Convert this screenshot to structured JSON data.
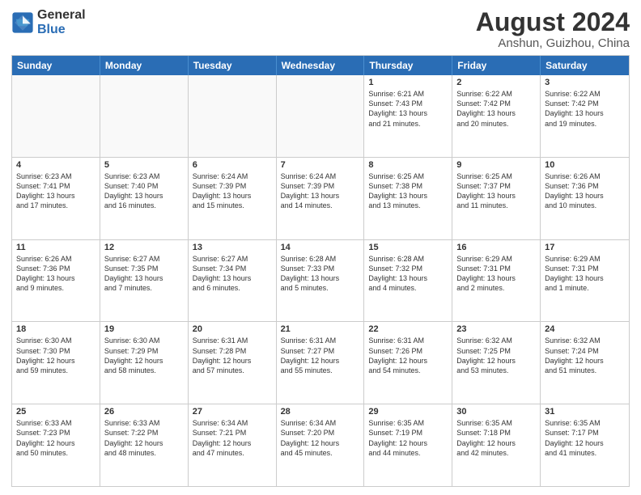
{
  "logo": {
    "line1": "General",
    "line2": "Blue"
  },
  "title": "August 2024",
  "subtitle": "Anshun, Guizhou, China",
  "header_days": [
    "Sunday",
    "Monday",
    "Tuesday",
    "Wednesday",
    "Thursday",
    "Friday",
    "Saturday"
  ],
  "rows": [
    [
      {
        "day": "",
        "text": "",
        "empty": true
      },
      {
        "day": "",
        "text": "",
        "empty": true
      },
      {
        "day": "",
        "text": "",
        "empty": true
      },
      {
        "day": "",
        "text": "",
        "empty": true
      },
      {
        "day": "1",
        "text": "Sunrise: 6:21 AM\nSunset: 7:43 PM\nDaylight: 13 hours\nand 21 minutes.",
        "empty": false
      },
      {
        "day": "2",
        "text": "Sunrise: 6:22 AM\nSunset: 7:42 PM\nDaylight: 13 hours\nand 20 minutes.",
        "empty": false
      },
      {
        "day": "3",
        "text": "Sunrise: 6:22 AM\nSunset: 7:42 PM\nDaylight: 13 hours\nand 19 minutes.",
        "empty": false
      }
    ],
    [
      {
        "day": "4",
        "text": "Sunrise: 6:23 AM\nSunset: 7:41 PM\nDaylight: 13 hours\nand 17 minutes.",
        "empty": false
      },
      {
        "day": "5",
        "text": "Sunrise: 6:23 AM\nSunset: 7:40 PM\nDaylight: 13 hours\nand 16 minutes.",
        "empty": false
      },
      {
        "day": "6",
        "text": "Sunrise: 6:24 AM\nSunset: 7:39 PM\nDaylight: 13 hours\nand 15 minutes.",
        "empty": false
      },
      {
        "day": "7",
        "text": "Sunrise: 6:24 AM\nSunset: 7:39 PM\nDaylight: 13 hours\nand 14 minutes.",
        "empty": false
      },
      {
        "day": "8",
        "text": "Sunrise: 6:25 AM\nSunset: 7:38 PM\nDaylight: 13 hours\nand 13 minutes.",
        "empty": false
      },
      {
        "day": "9",
        "text": "Sunrise: 6:25 AM\nSunset: 7:37 PM\nDaylight: 13 hours\nand 11 minutes.",
        "empty": false
      },
      {
        "day": "10",
        "text": "Sunrise: 6:26 AM\nSunset: 7:36 PM\nDaylight: 13 hours\nand 10 minutes.",
        "empty": false
      }
    ],
    [
      {
        "day": "11",
        "text": "Sunrise: 6:26 AM\nSunset: 7:36 PM\nDaylight: 13 hours\nand 9 minutes.",
        "empty": false
      },
      {
        "day": "12",
        "text": "Sunrise: 6:27 AM\nSunset: 7:35 PM\nDaylight: 13 hours\nand 7 minutes.",
        "empty": false
      },
      {
        "day": "13",
        "text": "Sunrise: 6:27 AM\nSunset: 7:34 PM\nDaylight: 13 hours\nand 6 minutes.",
        "empty": false
      },
      {
        "day": "14",
        "text": "Sunrise: 6:28 AM\nSunset: 7:33 PM\nDaylight: 13 hours\nand 5 minutes.",
        "empty": false
      },
      {
        "day": "15",
        "text": "Sunrise: 6:28 AM\nSunset: 7:32 PM\nDaylight: 13 hours\nand 4 minutes.",
        "empty": false
      },
      {
        "day": "16",
        "text": "Sunrise: 6:29 AM\nSunset: 7:31 PM\nDaylight: 13 hours\nand 2 minutes.",
        "empty": false
      },
      {
        "day": "17",
        "text": "Sunrise: 6:29 AM\nSunset: 7:31 PM\nDaylight: 13 hours\nand 1 minute.",
        "empty": false
      }
    ],
    [
      {
        "day": "18",
        "text": "Sunrise: 6:30 AM\nSunset: 7:30 PM\nDaylight: 12 hours\nand 59 minutes.",
        "empty": false
      },
      {
        "day": "19",
        "text": "Sunrise: 6:30 AM\nSunset: 7:29 PM\nDaylight: 12 hours\nand 58 minutes.",
        "empty": false
      },
      {
        "day": "20",
        "text": "Sunrise: 6:31 AM\nSunset: 7:28 PM\nDaylight: 12 hours\nand 57 minutes.",
        "empty": false
      },
      {
        "day": "21",
        "text": "Sunrise: 6:31 AM\nSunset: 7:27 PM\nDaylight: 12 hours\nand 55 minutes.",
        "empty": false
      },
      {
        "day": "22",
        "text": "Sunrise: 6:31 AM\nSunset: 7:26 PM\nDaylight: 12 hours\nand 54 minutes.",
        "empty": false
      },
      {
        "day": "23",
        "text": "Sunrise: 6:32 AM\nSunset: 7:25 PM\nDaylight: 12 hours\nand 53 minutes.",
        "empty": false
      },
      {
        "day": "24",
        "text": "Sunrise: 6:32 AM\nSunset: 7:24 PM\nDaylight: 12 hours\nand 51 minutes.",
        "empty": false
      }
    ],
    [
      {
        "day": "25",
        "text": "Sunrise: 6:33 AM\nSunset: 7:23 PM\nDaylight: 12 hours\nand 50 minutes.",
        "empty": false
      },
      {
        "day": "26",
        "text": "Sunrise: 6:33 AM\nSunset: 7:22 PM\nDaylight: 12 hours\nand 48 minutes.",
        "empty": false
      },
      {
        "day": "27",
        "text": "Sunrise: 6:34 AM\nSunset: 7:21 PM\nDaylight: 12 hours\nand 47 minutes.",
        "empty": false
      },
      {
        "day": "28",
        "text": "Sunrise: 6:34 AM\nSunset: 7:20 PM\nDaylight: 12 hours\nand 45 minutes.",
        "empty": false
      },
      {
        "day": "29",
        "text": "Sunrise: 6:35 AM\nSunset: 7:19 PM\nDaylight: 12 hours\nand 44 minutes.",
        "empty": false
      },
      {
        "day": "30",
        "text": "Sunrise: 6:35 AM\nSunset: 7:18 PM\nDaylight: 12 hours\nand 42 minutes.",
        "empty": false
      },
      {
        "day": "31",
        "text": "Sunrise: 6:35 AM\nSunset: 7:17 PM\nDaylight: 12 hours\nand 41 minutes.",
        "empty": false
      }
    ]
  ]
}
